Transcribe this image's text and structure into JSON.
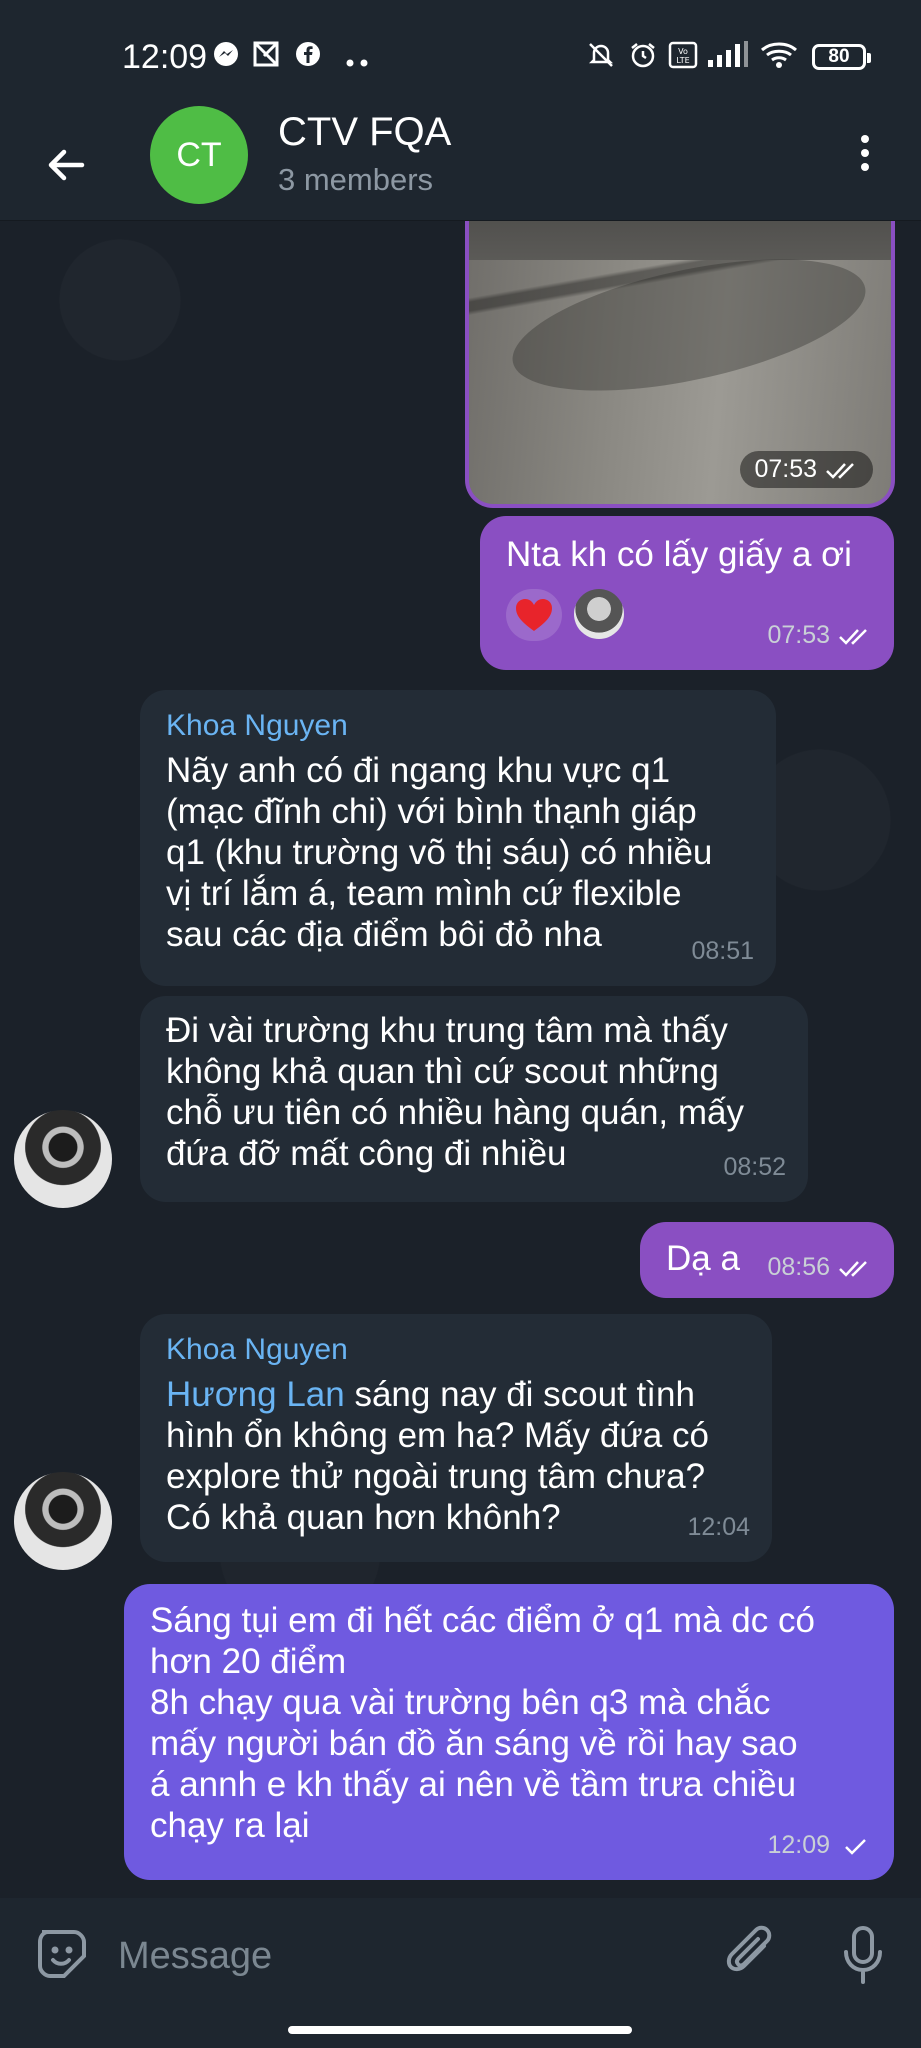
{
  "status_bar": {
    "time": "12:09",
    "notification_icons": [
      "messenger-icon",
      "app-icon",
      "facebook-icon",
      "more-dots-icon"
    ],
    "system_icons": [
      "mute-icon",
      "alarm-icon",
      "volte-icon",
      "signal-icon",
      "wifi-icon"
    ],
    "battery": "80"
  },
  "header": {
    "avatar_initials": "CT",
    "avatar_color": "#4fbd45",
    "title": "CTV FQA",
    "subtitle": "3 members"
  },
  "messages": [
    {
      "type": "photo",
      "direction": "out",
      "time": "07:53",
      "status": "read"
    },
    {
      "type": "text",
      "direction": "out",
      "text": "Nta kh có lấy giấy a ơi",
      "time": "07:53",
      "status": "read",
      "reactions": [
        "❤️",
        "avatar"
      ]
    },
    {
      "type": "text",
      "direction": "in",
      "sender": "Khoa Nguyen",
      "lines": [
        "Nãy anh có đi ngang khu vực q1",
        "(mạc đĩnh chi) với bình thạnh giáp",
        "q1 (khu trường võ thị sáu) có nhiều",
        "vị trí lắm á, team mình cứ flexible",
        "sau các địa điểm bôi đỏ nha"
      ],
      "time": "08:51"
    },
    {
      "type": "text",
      "direction": "in",
      "lines": [
        "Đi vài trường khu trung tâm mà thấy",
        "không khả quan thì cứ scout những",
        "chỗ ưu tiên có nhiều hàng quán, mấy",
        "đứa đỡ mất công đi nhiều"
      ],
      "time": "08:52"
    },
    {
      "type": "text",
      "direction": "out",
      "text": "Dạ a",
      "time": "08:56",
      "status": "read"
    },
    {
      "type": "text",
      "direction": "in",
      "sender": "Khoa Nguyen",
      "mention": "Hương Lan",
      "lines": [
        " sáng nay đi scout tình",
        "hình ổn không em ha? Mấy đứa có",
        "explore thử ngoài trung tâm chưa?",
        "Có khả quan hơn khônh?"
      ],
      "time": "12:04"
    },
    {
      "type": "text",
      "direction": "out",
      "lines": [
        "Sáng tụi em đi hết các điểm ở q1 mà dc có",
        "hơn 20 điểm",
        "8h chạy qua vài trường bên q3 mà chắc",
        "mấy người bán đồ ăn sáng về rồi hay sao",
        "á annh e kh thấy ai nên về tầm trưa chiều",
        "chạy ra lại"
      ],
      "time": "12:09",
      "status": "sent"
    }
  ],
  "input": {
    "placeholder": "Message"
  },
  "colors": {
    "outgoing": "#8a4fc2",
    "outgoing_latest": "#6f5ae0",
    "incoming": "#232c36",
    "sender_name": "#6ab4f3",
    "background": "#1b2129"
  }
}
